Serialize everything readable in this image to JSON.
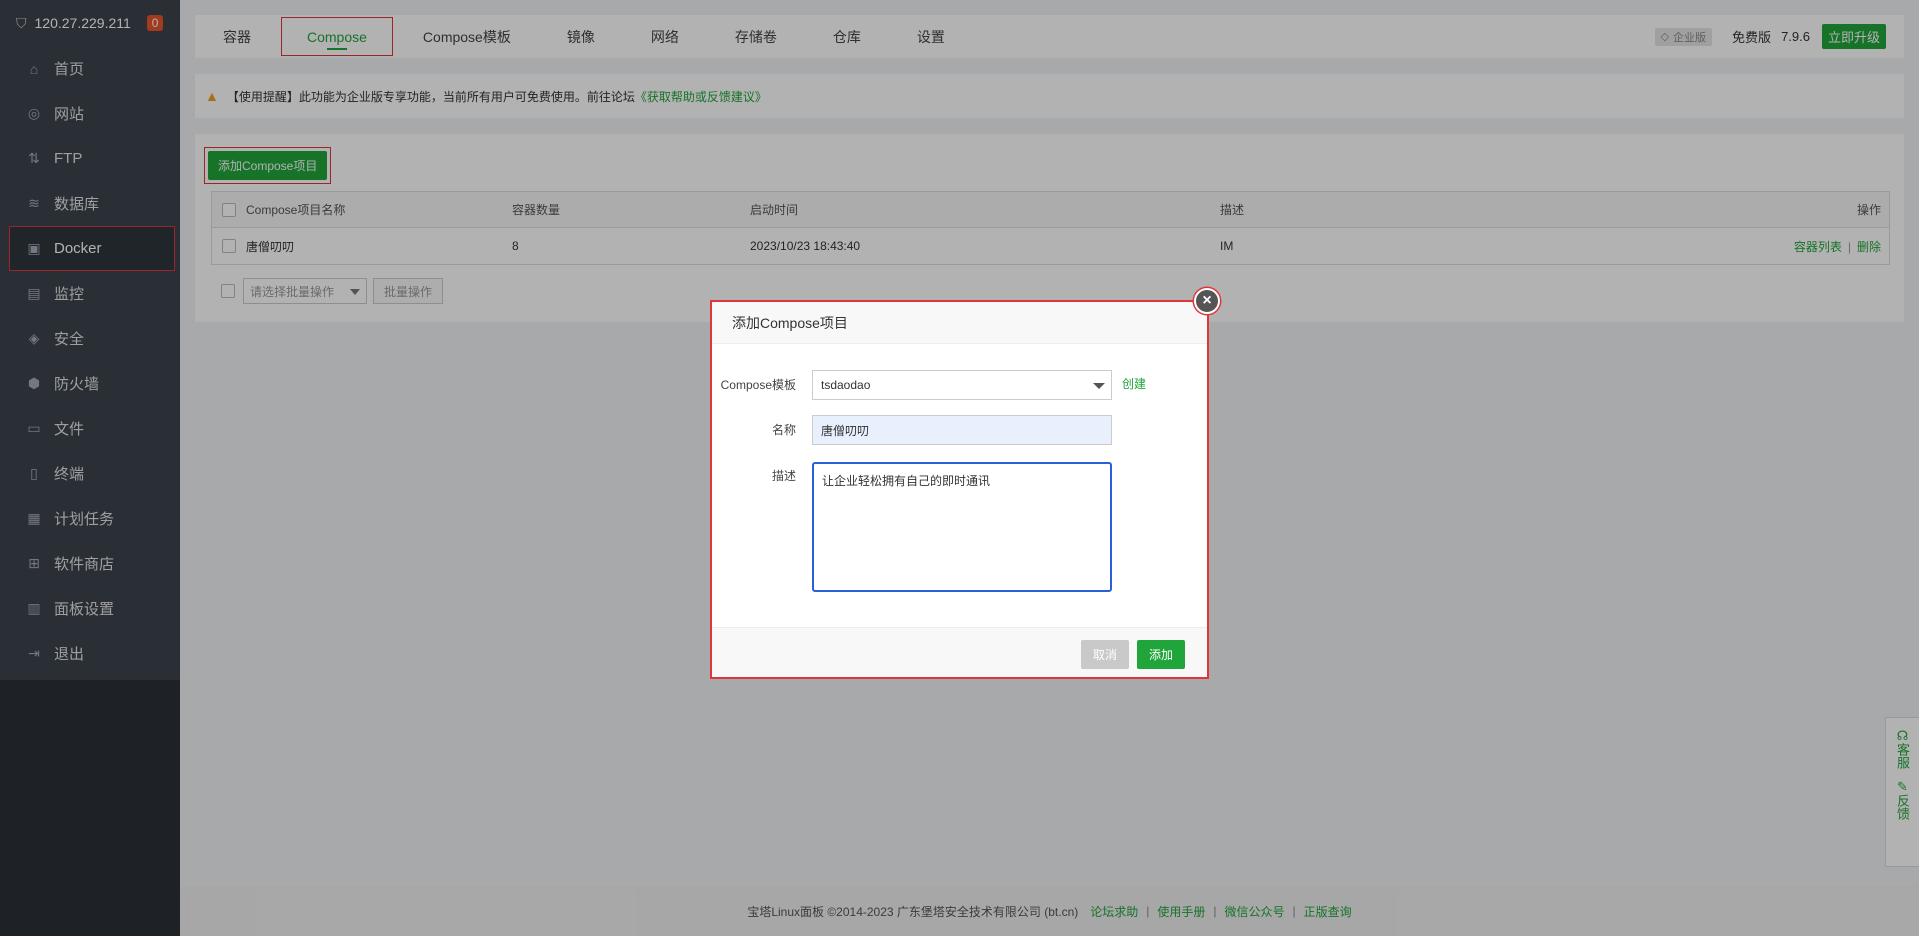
{
  "sidebar": {
    "ip": "120.27.229.211",
    "badge": "0",
    "items": [
      {
        "label": "首页",
        "icon": "home-icon"
      },
      {
        "label": "网站",
        "icon": "globe-icon"
      },
      {
        "label": "FTP",
        "icon": "ftp-icon"
      },
      {
        "label": "数据库",
        "icon": "database-icon"
      },
      {
        "label": "Docker",
        "icon": "docker-icon"
      },
      {
        "label": "监控",
        "icon": "monitor-icon"
      },
      {
        "label": "安全",
        "icon": "shield-icon"
      },
      {
        "label": "防火墙",
        "icon": "firewall-icon"
      },
      {
        "label": "文件",
        "icon": "folder-icon"
      },
      {
        "label": "终端",
        "icon": "terminal-icon"
      },
      {
        "label": "计划任务",
        "icon": "calendar-icon"
      },
      {
        "label": "软件商店",
        "icon": "apps-icon"
      },
      {
        "label": "面板设置",
        "icon": "settings-icon"
      },
      {
        "label": "退出",
        "icon": "logout-icon"
      }
    ]
  },
  "tabs": [
    "容器",
    "Compose",
    "Compose模板",
    "镜像",
    "网络",
    "存储卷",
    "仓库",
    "设置"
  ],
  "header": {
    "enterprise": "企业版",
    "free": "免费版",
    "version": "7.9.6",
    "upgrade": "立即升级"
  },
  "notice": {
    "text": "【使用提醒】此功能为企业版专享功能，当前所有用户可免费使用。前往论坛",
    "link": "《获取帮助或反馈建议》"
  },
  "panel": {
    "add_button": "添加Compose项目",
    "columns": [
      "Compose项目名称",
      "容器数量",
      "启动时间",
      "描述",
      "操作"
    ],
    "rows": [
      {
        "name": "唐僧叨叨",
        "count": "8",
        "time": "2023/10/23 18:43:40",
        "desc": "IM",
        "op1": "容器列表",
        "sep": "|",
        "op2": "删除"
      }
    ],
    "batch_placeholder": "请选择批量操作",
    "batch_button": "批量操作"
  },
  "footer": {
    "copyright": "宝塔Linux面板 ©2014-2023 广东堡塔安全技术有限公司 (bt.cn)",
    "links": [
      "论坛求助",
      "使用手册",
      "微信公众号",
      "正版查询"
    ],
    "sep": "|"
  },
  "float": {
    "service": "客服",
    "feedback": "反馈"
  },
  "modal": {
    "title": "添加Compose项目",
    "template_label": "Compose模板",
    "template_value": "tsdaodao",
    "create_link": "创建",
    "name_label": "名称",
    "name_value": "唐僧叨叨",
    "desc_label": "描述",
    "desc_value": "让企业轻松拥有自己的即时通讯",
    "cancel": "取消",
    "add": "添加"
  },
  "colors": {
    "accent": "#20a53a",
    "highlight": "#e0353a",
    "sidebar": "#3c444d"
  }
}
